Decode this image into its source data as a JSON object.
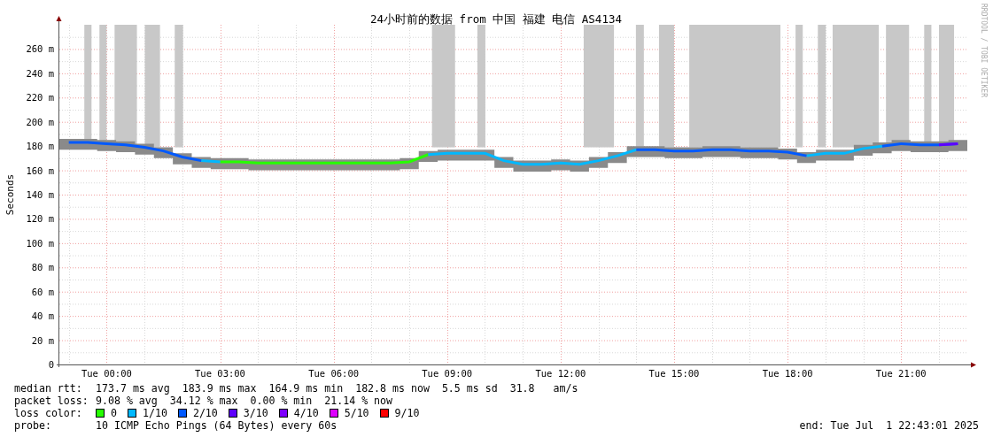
{
  "graph": {
    "title": "24小时前的数据 from 中国 福建 电信 AS4134",
    "credit": "RRDTOOL / TOBI OETIKER",
    "chart_data": {
      "type": "line",
      "ylabel": "Seconds",
      "ylim": [
        0,
        280
      ],
      "grid": true,
      "categories": [
        null,
        null,
        "Tue 00:00",
        null,
        null,
        null,
        null,
        null,
        "Tue 03:00",
        null,
        null,
        null,
        null,
        null,
        "Tue 06:00",
        null,
        null,
        null,
        null,
        null,
        "Tue 09:00",
        null,
        null,
        null,
        null,
        null,
        "Tue 12:00",
        null,
        null,
        null,
        null,
        null,
        "Tue 15:00",
        null,
        null,
        null,
        null,
        null,
        "Tue 18:00",
        null,
        null,
        null,
        null,
        null,
        "Tue 21:00",
        null,
        null,
        null
      ],
      "yticks": [
        {
          "value": 0,
          "label": "0"
        },
        {
          "value": 20,
          "label": "20 m"
        },
        {
          "value": 40,
          "label": "40 m"
        },
        {
          "value": 60,
          "label": "60 m"
        },
        {
          "value": 80,
          "label": "80 m"
        },
        {
          "value": 100,
          "label": "100 m"
        },
        {
          "value": 120,
          "label": "120 m"
        },
        {
          "value": 140,
          "label": "140 m"
        },
        {
          "value": 160,
          "label": "160 m"
        },
        {
          "value": 180,
          "label": "180 m"
        },
        {
          "value": 200,
          "label": "200 m"
        },
        {
          "value": 220,
          "label": "220 m"
        },
        {
          "value": 240,
          "label": "240 m"
        },
        {
          "value": 260,
          "label": "260 m"
        }
      ],
      "series": [
        {
          "name": "0",
          "color": "#26ff00",
          "values": [
            null,
            null,
            null,
            null,
            null,
            null,
            null,
            null,
            167,
            167,
            166,
            166,
            166,
            166,
            166,
            166,
            166,
            166,
            167,
            173,
            null,
            null,
            null,
            null,
            null,
            null,
            null,
            null,
            null,
            null,
            null,
            null,
            null,
            null,
            null,
            null,
            null,
            null,
            null,
            null,
            null,
            null,
            null,
            null,
            null,
            null,
            null,
            null
          ]
        },
        {
          "name": "1/10",
          "color": "#00b8ff",
          "values": [
            null,
            null,
            null,
            null,
            null,
            null,
            null,
            168,
            167,
            null,
            null,
            null,
            null,
            null,
            null,
            null,
            null,
            null,
            null,
            173,
            174,
            174,
            174,
            168,
            165,
            165,
            166,
            165,
            168,
            172,
            177,
            null,
            null,
            null,
            null,
            null,
            null,
            null,
            null,
            172,
            174,
            174,
            178,
            180,
            null,
            null,
            null,
            null
          ]
        },
        {
          "name": "2/10",
          "color": "#0059ff",
          "values": [
            183,
            183,
            182,
            181,
            179,
            176,
            171,
            168,
            null,
            null,
            null,
            null,
            null,
            null,
            null,
            null,
            null,
            null,
            null,
            null,
            null,
            null,
            null,
            null,
            null,
            null,
            null,
            null,
            null,
            null,
            177,
            177,
            176,
            176,
            177,
            177,
            176,
            176,
            175,
            172,
            null,
            null,
            null,
            180,
            182,
            181,
            181,
            182
          ]
        },
        {
          "name": "3/10",
          "color": "#5e00ff",
          "values": [
            null,
            null,
            null,
            null,
            null,
            null,
            null,
            null,
            null,
            null,
            null,
            null,
            null,
            null,
            null,
            null,
            null,
            null,
            null,
            null,
            null,
            null,
            null,
            null,
            null,
            null,
            null,
            null,
            null,
            null,
            null,
            null,
            null,
            null,
            null,
            null,
            null,
            null,
            null,
            null,
            null,
            null,
            null,
            null,
            null,
            null,
            181,
            182
          ]
        },
        {
          "name": "4/10",
          "color": "#7e00ff",
          "values": [
            null,
            null,
            null,
            null,
            null,
            null,
            null,
            null,
            null,
            null,
            null,
            null,
            null,
            null,
            null,
            null,
            null,
            null,
            null,
            null,
            null,
            null,
            null,
            null,
            null,
            null,
            null,
            null,
            null,
            null,
            null,
            null,
            null,
            null,
            null,
            null,
            null,
            null,
            null,
            null,
            null,
            null,
            null,
            null,
            null,
            null,
            null,
            null
          ]
        },
        {
          "name": "5/10",
          "color": "#dd00ff",
          "values": [
            null,
            null,
            null,
            null,
            null,
            null,
            null,
            null,
            null,
            null,
            null,
            null,
            null,
            null,
            null,
            null,
            null,
            null,
            null,
            null,
            null,
            null,
            null,
            null,
            null,
            null,
            null,
            null,
            null,
            null,
            null,
            null,
            null,
            null,
            null,
            null,
            null,
            null,
            null,
            null,
            null,
            null,
            null,
            null,
            null,
            null,
            null,
            null
          ]
        },
        {
          "name": "9/10",
          "color": "#ff0000",
          "values": [
            null,
            null,
            null,
            null,
            null,
            null,
            null,
            null,
            null,
            null,
            null,
            null,
            null,
            null,
            null,
            null,
            null,
            null,
            null,
            null,
            null,
            null,
            null,
            null,
            null,
            null,
            null,
            null,
            null,
            null,
            null,
            null,
            null,
            null,
            null,
            null,
            null,
            null,
            null,
            null,
            null,
            null,
            null,
            null,
            null,
            null,
            null,
            null
          ]
        }
      ]
    }
  },
  "legend": {
    "rows": [
      {
        "label": "median rtt:",
        "text": "173.7 ms avg  183.9 ms max  164.9 ms min  182.8 ms now  5.5 ms sd  31.8   am/s"
      },
      {
        "label": "packet loss:",
        "text": "9.08 % avg  34.12 % max  0.00 % min  21.14 % now"
      }
    ],
    "loss_color_label": "loss color:",
    "probe": {
      "label": "probe:",
      "text": "10 ICMP Echo Pings (64 Bytes) every 60s"
    },
    "end": "end: Tue Jul  1 22:43:01 2025"
  }
}
